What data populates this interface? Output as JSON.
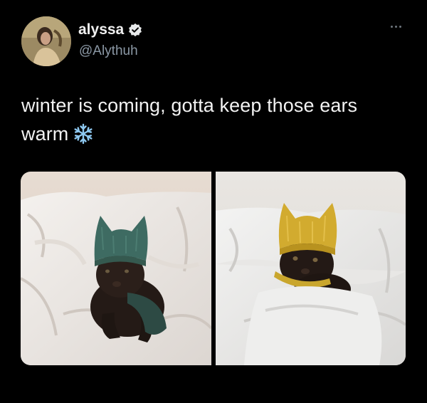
{
  "author": {
    "display_name": "alyssa",
    "handle": "@Alythuh",
    "verified": true,
    "avatar_icon": "avatar-photo"
  },
  "tweet": {
    "text": "winter is coming, gotta keep those ears warm",
    "emoji": "snowflake-icon"
  },
  "media": {
    "count": 2,
    "photos": [
      {
        "icon": "cat-green-hat-photo"
      },
      {
        "icon": "cat-yellow-hat-photo"
      }
    ]
  },
  "colors": {
    "background": "#000000",
    "text": "#f2f2f2",
    "handle": "#8b98a5",
    "verified_badge": "#e7e9ea",
    "snowflake": "#8ec8f0"
  }
}
